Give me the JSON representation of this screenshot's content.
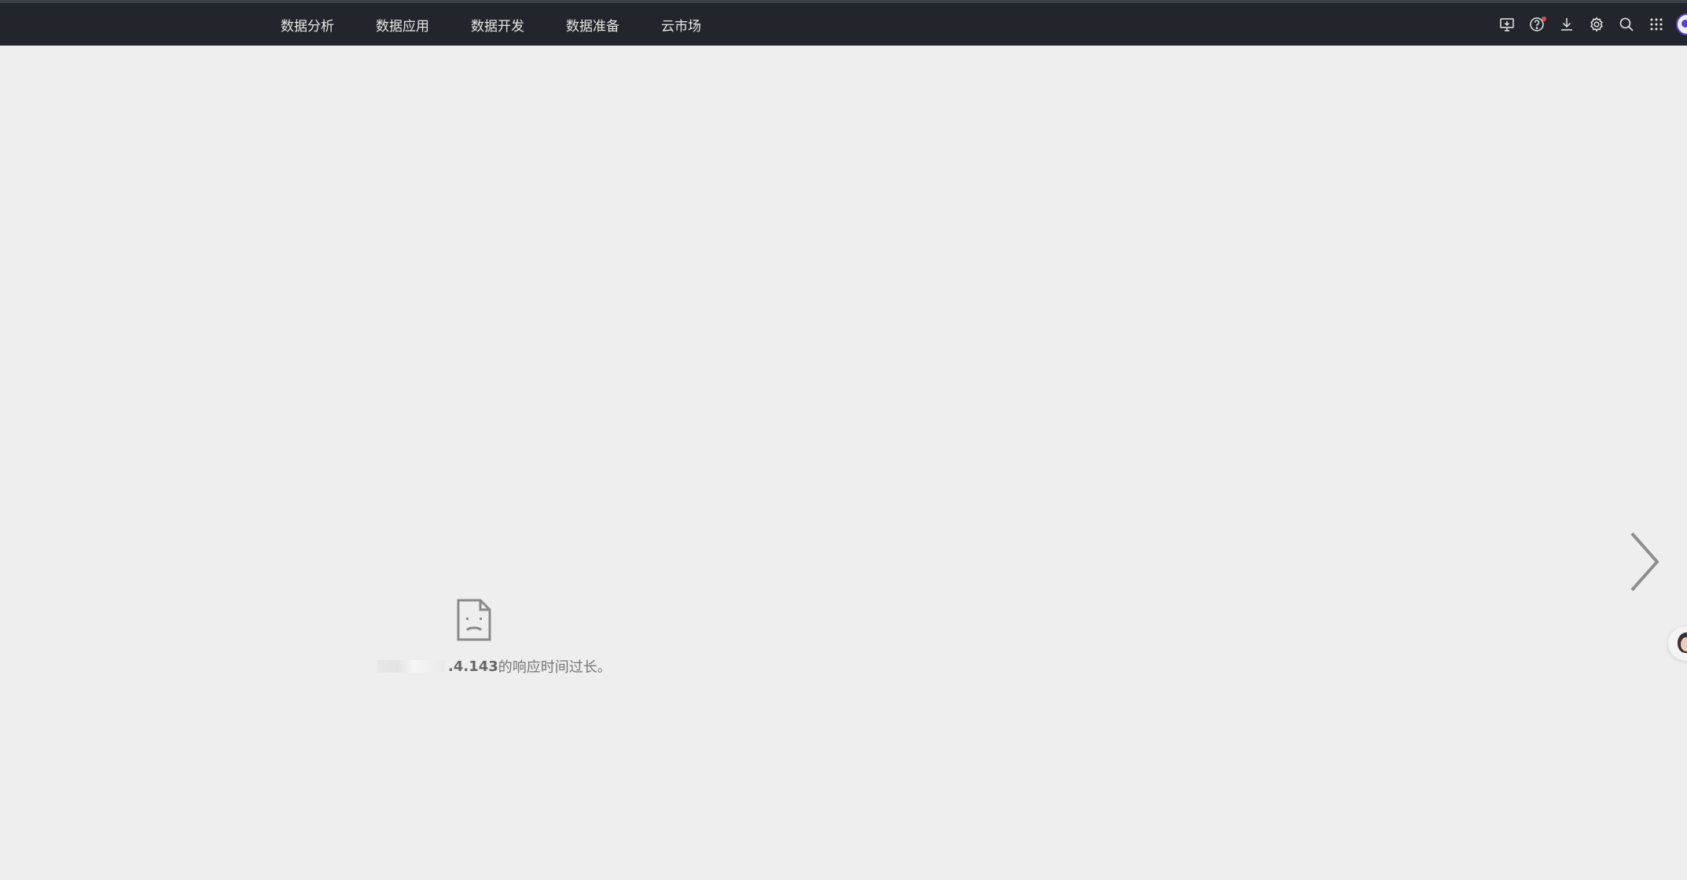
{
  "nav": {
    "items": [
      {
        "label": "数据分析"
      },
      {
        "label": "数据应用"
      },
      {
        "label": "数据开发"
      },
      {
        "label": "数据准备"
      },
      {
        "label": "云市场"
      }
    ]
  },
  "toolbar": {
    "icons": [
      "monitor-download-icon",
      "help-icon",
      "download-icon",
      "gear-icon",
      "search-icon",
      "apps-grid-icon"
    ],
    "help_badge_color": "#e5484d"
  },
  "error": {
    "host_suffix": ".4.143",
    "message": " 的响应时间过长。"
  },
  "colors": {
    "topbar_bg": "#22262c",
    "page_bg": "#eeeeee"
  }
}
